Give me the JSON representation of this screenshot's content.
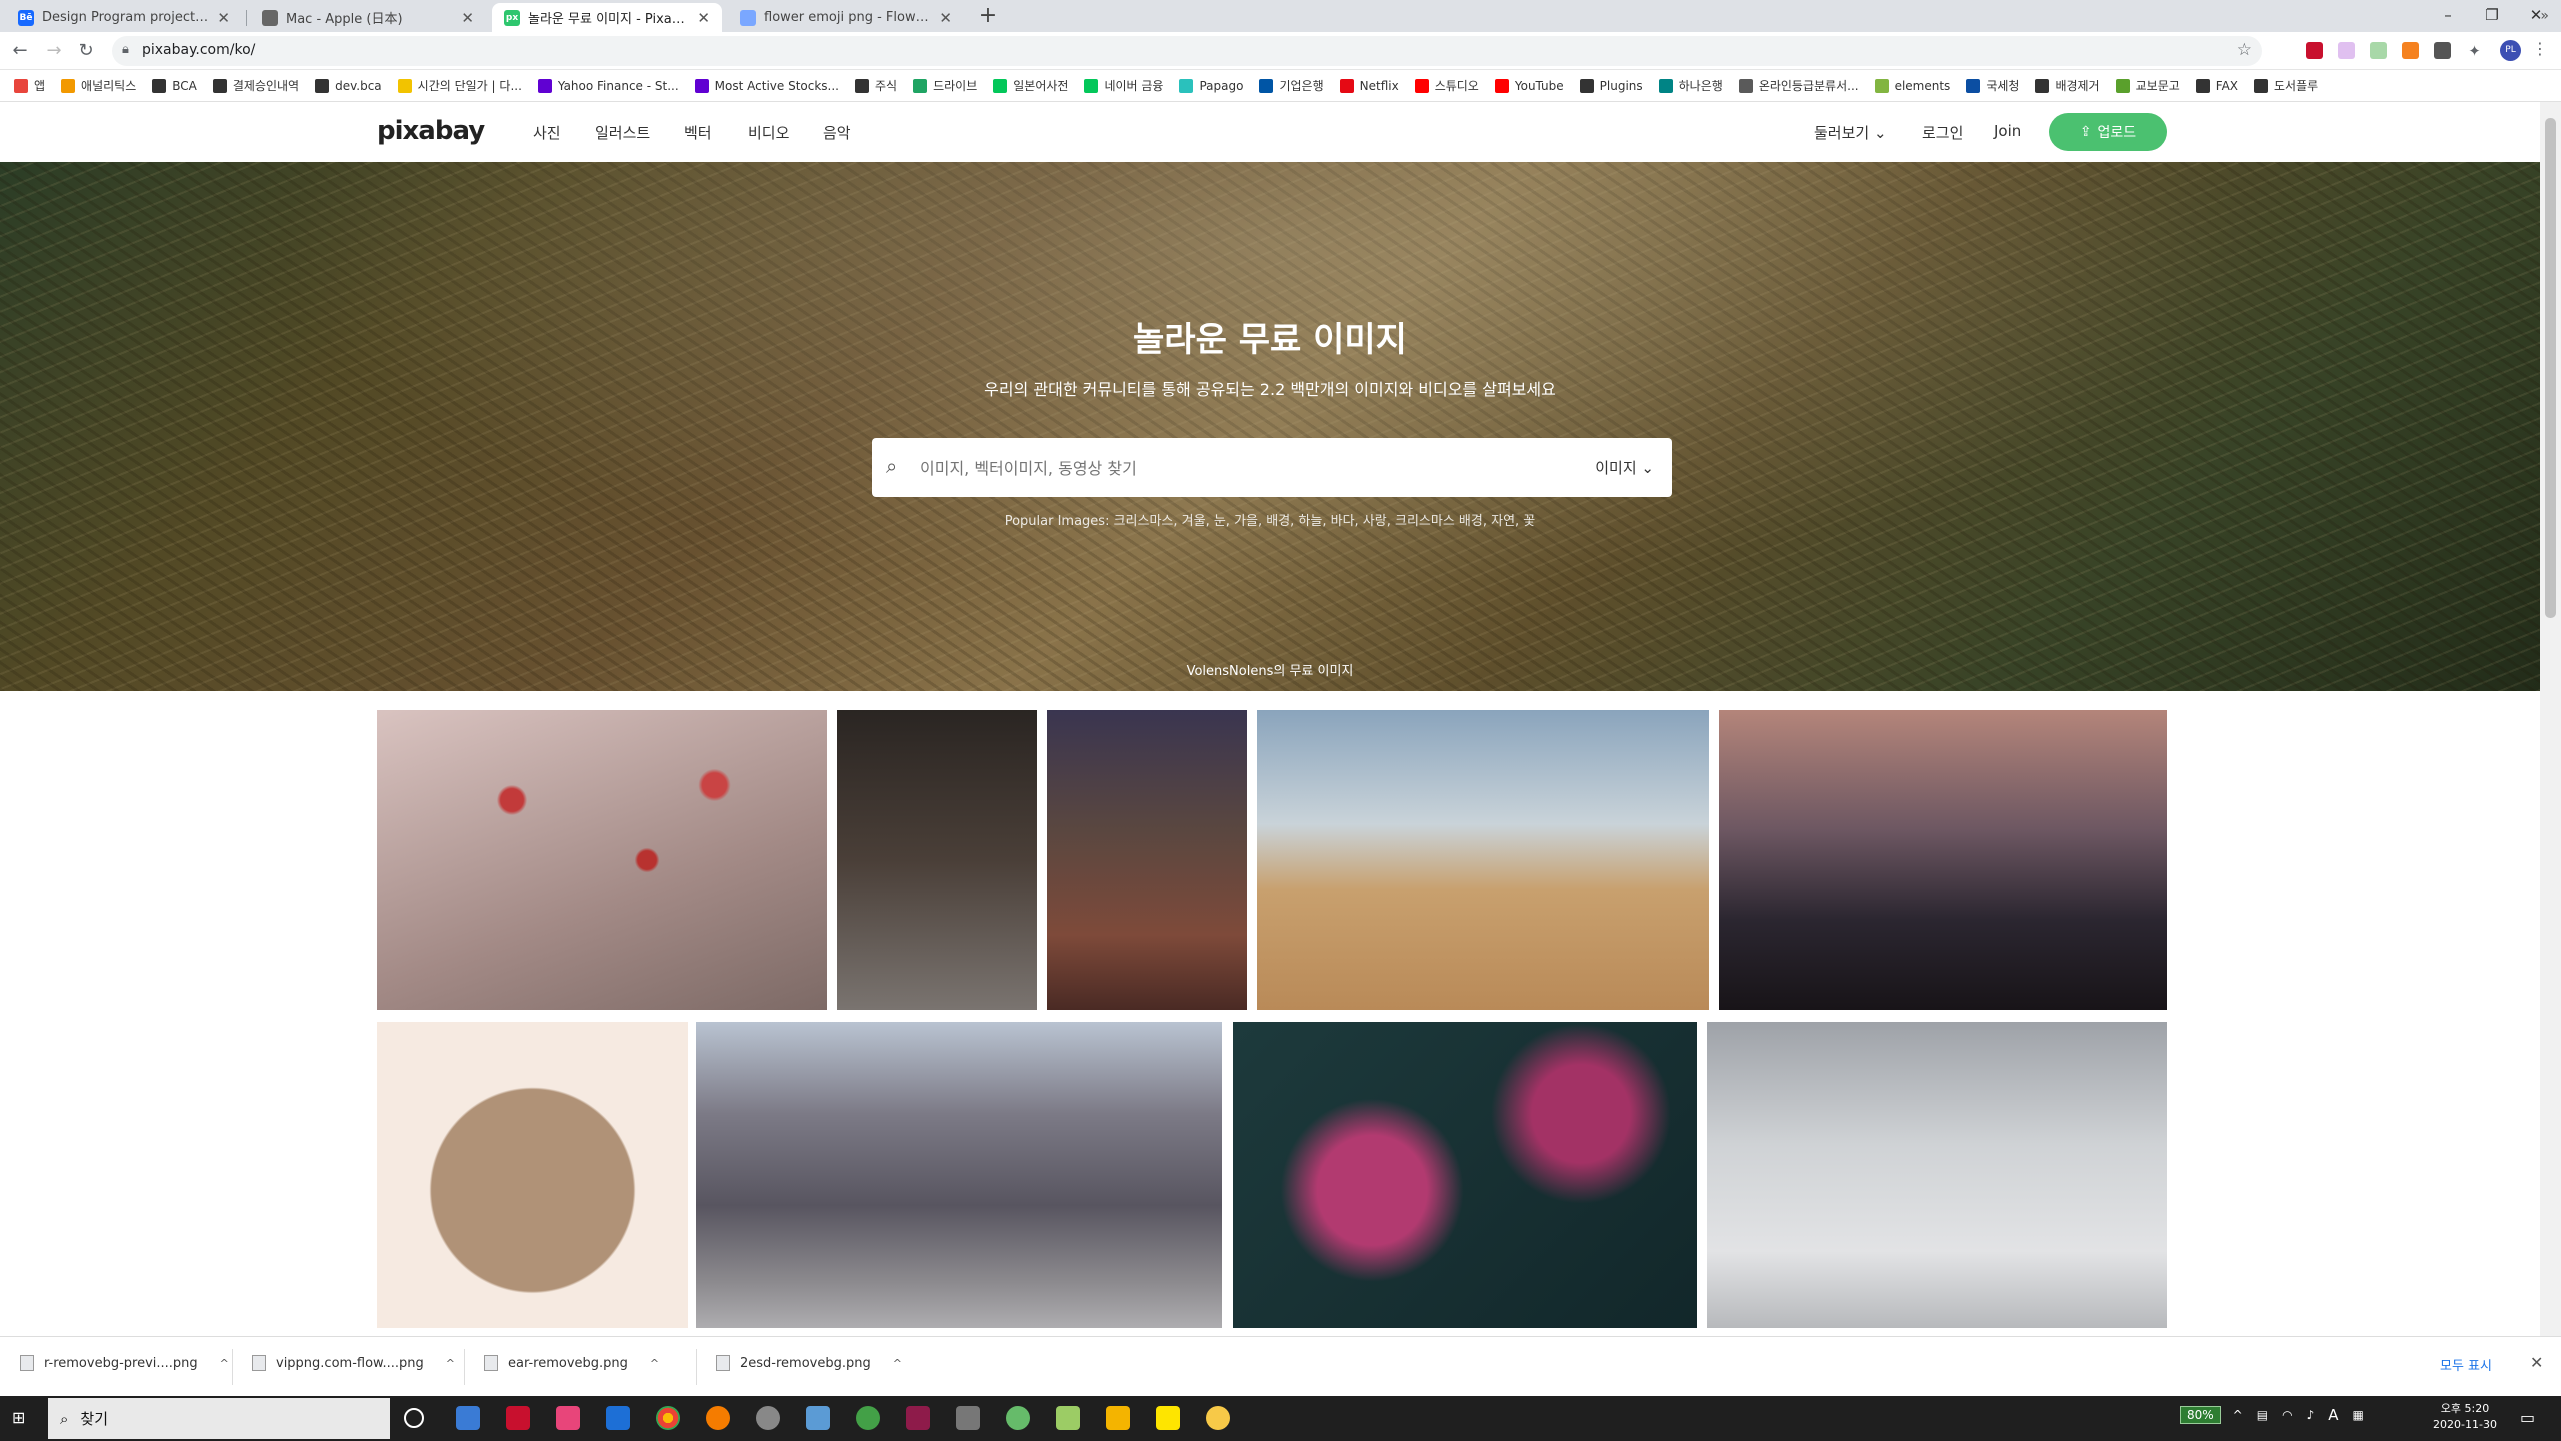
{
  "browser": {
    "tabs": [
      {
        "label": "Design Program projects | Behance",
        "favicon_color": "#1769ff",
        "favicon": "Bē"
      },
      {
        "label": "Mac - Apple (日本)",
        "favicon_color": "#666666",
        "favicon": ""
      },
      {
        "label": "놀라운 무료 이미지 - Pixabay",
        "favicon_color": "#2ec66e",
        "favicon": "px"
      },
      {
        "label": "flower emoji png - Flower Emoji",
        "favicon_color": "#7aa7ff",
        "favicon": ""
      }
    ],
    "new_tab": "+",
    "window_controls": {
      "minimize": "–",
      "restore": "❐",
      "close": "✕"
    },
    "url": "pixabay.com/ko/",
    "bookmarks": [
      {
        "label": "앱",
        "color": "#e8453c"
      },
      {
        "label": "애널리틱스",
        "color": "#f29900"
      },
      {
        "label": "BCA",
        "color": "#333333"
      },
      {
        "label": "결제승인내역",
        "color": "#333333"
      },
      {
        "label": "dev.bca",
        "color": "#333333"
      },
      {
        "label": "시간의 단일가 | 다...",
        "color": "#f2c300"
      },
      {
        "label": "Yahoo Finance - St...",
        "color": "#6001d2"
      },
      {
        "label": "Most Active Stocks...",
        "color": "#6001d2"
      },
      {
        "label": "주식",
        "color": "#333333"
      },
      {
        "label": "드라이브",
        "color": "#1fa463"
      },
      {
        "label": "일본어사전",
        "color": "#03c75a"
      },
      {
        "label": "네이버 금융",
        "color": "#03c75a"
      },
      {
        "label": "Papago",
        "color": "#2ac1bc"
      },
      {
        "label": "기업은행",
        "color": "#0055a5"
      },
      {
        "label": "Netflix",
        "color": "#e50914"
      },
      {
        "label": "스튜디오",
        "color": "#ff0000"
      },
      {
        "label": "YouTube",
        "color": "#ff0000"
      },
      {
        "label": "Plugins",
        "color": "#333333"
      },
      {
        "label": "하나은행",
        "color": "#008485"
      },
      {
        "label": "온라인등급분류서...",
        "color": "#5a5a5a"
      },
      {
        "label": "elements",
        "color": "#82b541"
      },
      {
        "label": "국세청",
        "color": "#0b4ea2"
      },
      {
        "label": "배경제거",
        "color": "#333333"
      },
      {
        "label": "교보문고",
        "color": "#5aa02c"
      },
      {
        "label": "FAX",
        "color": "#333333"
      },
      {
        "label": "도서플루",
        "color": "#333333"
      }
    ],
    "bookmarks_more": "»"
  },
  "pixabay": {
    "logo": "pixabay",
    "nav": [
      "사진",
      "일러스트",
      "벡터",
      "비디오",
      "음악"
    ],
    "browse": "둘러보기 ⌄",
    "login": "로그인",
    "join": "Join",
    "upload": "업로드",
    "hero": {
      "title": "놀라운 무료 이미지",
      "subtitle": "우리의 관대한 커뮤니티를 통해 공유되는 2.2 백만개의 이미지와 비디오를 살펴보세요",
      "search_placeholder": "이미지, 벡터이미지, 동영상 찾기",
      "search_type": "이미지 ⌄",
      "popular": "Popular Images: 크리스마스, 겨울, 눈, 가을, 배경, 하늘, 바다, 사랑, 크리스마스 배경, 자연, 꽃",
      "credit": "VolensNolens의 무료 이미지"
    }
  },
  "downloads": {
    "items": [
      "r-removebg-previ....png",
      "vippng.com-flow....png",
      "ear-removebg.png",
      "2esd-removebg.png"
    ],
    "show_all": "모두 표시",
    "close": "✕"
  },
  "taskbar": {
    "search_placeholder": "찾기",
    "battery": "80%",
    "ime": "A",
    "time": "오후 5:20",
    "date": "2020-11-30"
  }
}
